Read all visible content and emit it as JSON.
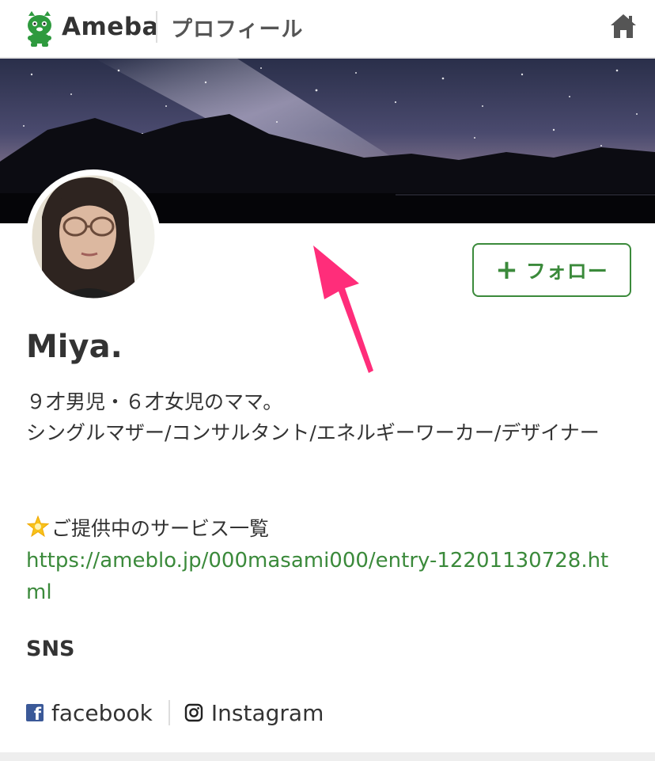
{
  "header": {
    "brand": "Ameba",
    "page_title": "プロフィール",
    "home_icon": "home-icon"
  },
  "profile": {
    "name": "Miya.",
    "follow_plus": "+",
    "follow_label": "フォロー",
    "bio_line1": "９才男児・６才女児のママ。",
    "bio_line2": "シングルマザー/コンサルタント/エネルギーワーカー/デザイナー",
    "service_label": "ご提供中のサービス一覧",
    "service_icon": "glowing-star-icon",
    "service_url": "https://ameblo.jp/000masami000/entry-12201130728.html"
  },
  "sns": {
    "heading": "SNS",
    "links": [
      {
        "label": "facebook",
        "icon": "facebook-icon"
      },
      {
        "label": "Instagram",
        "icon": "instagram-icon"
      }
    ]
  },
  "colors": {
    "accent_green": "#3b8a3b",
    "annotation_pink": "#ff2d7a",
    "facebook_blue": "#3b5998"
  }
}
